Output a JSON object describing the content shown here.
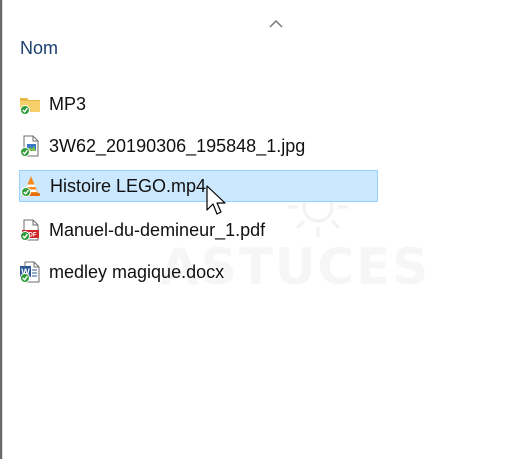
{
  "header": {
    "column_name": "Nom"
  },
  "files": [
    {
      "name": "MP3",
      "icon": "folder-icon",
      "selected": false
    },
    {
      "name": "3W62_20190306_195848_1.jpg",
      "icon": "image-file-icon",
      "selected": false
    },
    {
      "name": "Histoire LEGO.mp4",
      "icon": "vlc-media-icon",
      "selected": true
    },
    {
      "name": "Manuel-du-demineur_1.pdf",
      "icon": "pdf-file-icon",
      "selected": false
    },
    {
      "name": "medley magique.docx",
      "icon": "word-document-icon",
      "selected": false
    }
  ],
  "watermark": "ASTUCES",
  "colors": {
    "selection_fill": "#cce8ff",
    "selection_border": "#99d1ff",
    "header_text": "#1c3f6e",
    "sync_badge": "#2e9b36"
  }
}
